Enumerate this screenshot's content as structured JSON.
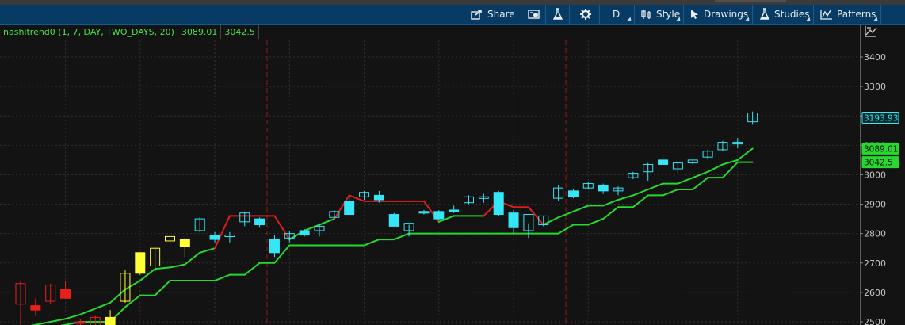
{
  "toolbar": {
    "share": "Share",
    "aggregation": "D",
    "style": "Style",
    "drawings": "Drawings",
    "studies": "Studies",
    "patterns": "Patterns"
  },
  "study": {
    "name": "nashitrend0 (1, 7, DAY, TWO_DAYS, 20)",
    "value1": "3089.01",
    "value2": "3042.5"
  },
  "colors": {
    "toolbar_bg": "#073b63",
    "chart_bg": "#131313",
    "candle_yellow": "#ffff33",
    "candle_red": "#e8201a",
    "candle_cyan": "#35e6f6",
    "trend_green": "#27d92f",
    "trend_red": "#e01c1c",
    "grid": "#2f2f2f",
    "divider": "#9a1a1a"
  },
  "chart_data": {
    "type": "candlestick",
    "y_axis_ticks": [
      2500,
      2600,
      2700,
      2800,
      2900,
      3000,
      3100,
      3200,
      3300,
      3400
    ],
    "ylim": [
      2490,
      3460
    ],
    "price_labels": [
      {
        "text": "3193.93",
        "value": 3193.93,
        "color": "#35e6f6",
        "filled": false
      },
      {
        "text": "3089.01",
        "value": 3089.01,
        "color": "#27d92f",
        "filled": true
      },
      {
        "text": "3042.5",
        "value": 3042.5,
        "color": "#27d92f",
        "filled": true
      }
    ],
    "candles": [
      {
        "o": 2560,
        "h": 2640,
        "l": 2490,
        "c": 2630,
        "color": "red",
        "filled": false
      },
      {
        "o": 2555,
        "h": 2580,
        "l": 2520,
        "c": 2540,
        "color": "red",
        "filled": true
      },
      {
        "o": 2570,
        "h": 2630,
        "l": 2560,
        "c": 2625,
        "color": "red",
        "filled": false
      },
      {
        "o": 2610,
        "h": 2640,
        "l": 2590,
        "c": 2580,
        "color": "red",
        "filled": true
      },
      {
        "o": 2500,
        "h": 2510,
        "l": 2480,
        "c": 2495,
        "color": "red",
        "filled": true
      },
      {
        "o": 2485,
        "h": 2520,
        "l": 2470,
        "c": 2515,
        "color": "red",
        "filled": false
      },
      {
        "o": 2515,
        "h": 2540,
        "l": 2490,
        "c": 2490,
        "color": "yellow",
        "filled": true
      },
      {
        "o": 2570,
        "h": 2675,
        "l": 2565,
        "c": 2665,
        "color": "yellow",
        "filled": false
      },
      {
        "o": 2665,
        "h": 2730,
        "l": 2660,
        "c": 2735,
        "color": "yellow",
        "filled": true
      },
      {
        "o": 2690,
        "h": 2755,
        "l": 2670,
        "c": 2750,
        "color": "yellow",
        "filled": false
      },
      {
        "o": 2775,
        "h": 2820,
        "l": 2760,
        "c": 2790,
        "color": "yellow",
        "filled": false
      },
      {
        "o": 2780,
        "h": 2785,
        "l": 2720,
        "c": 2755,
        "color": "yellow",
        "filled": true
      },
      {
        "o": 2810,
        "h": 2855,
        "l": 2805,
        "c": 2850,
        "color": "cyan",
        "filled": false
      },
      {
        "o": 2795,
        "h": 2805,
        "l": 2770,
        "c": 2780,
        "color": "cyan",
        "filled": true
      },
      {
        "o": 2790,
        "h": 2805,
        "l": 2770,
        "c": 2795,
        "color": "cyan",
        "filled": false
      },
      {
        "o": 2840,
        "h": 2875,
        "l": 2825,
        "c": 2870,
        "color": "cyan",
        "filled": false
      },
      {
        "o": 2850,
        "h": 2855,
        "l": 2820,
        "c": 2830,
        "color": "cyan",
        "filled": true
      },
      {
        "o": 2780,
        "h": 2795,
        "l": 2720,
        "c": 2735,
        "color": "cyan",
        "filled": true
      },
      {
        "o": 2785,
        "h": 2810,
        "l": 2770,
        "c": 2800,
        "color": "cyan",
        "filled": false
      },
      {
        "o": 2810,
        "h": 2815,
        "l": 2790,
        "c": 2795,
        "color": "cyan",
        "filled": true
      },
      {
        "o": 2810,
        "h": 2835,
        "l": 2790,
        "c": 2825,
        "color": "cyan",
        "filled": false
      },
      {
        "o": 2855,
        "h": 2880,
        "l": 2845,
        "c": 2875,
        "color": "cyan",
        "filled": false
      },
      {
        "o": 2910,
        "h": 2925,
        "l": 2865,
        "c": 2865,
        "color": "cyan",
        "filled": true
      },
      {
        "o": 2925,
        "h": 2945,
        "l": 2915,
        "c": 2940,
        "color": "cyan",
        "filled": false
      },
      {
        "o": 2930,
        "h": 2945,
        "l": 2905,
        "c": 2915,
        "color": "cyan",
        "filled": true
      },
      {
        "o": 2865,
        "h": 2870,
        "l": 2825,
        "c": 2825,
        "color": "cyan",
        "filled": true
      },
      {
        "o": 2810,
        "h": 2830,
        "l": 2790,
        "c": 2835,
        "color": "cyan",
        "filled": false
      },
      {
        "o": 2875,
        "h": 2880,
        "l": 2865,
        "c": 2875,
        "color": "cyan",
        "filled": true
      },
      {
        "o": 2875,
        "h": 2880,
        "l": 2845,
        "c": 2850,
        "color": "cyan",
        "filled": true
      },
      {
        "o": 2880,
        "h": 2895,
        "l": 2870,
        "c": 2880,
        "color": "cyan",
        "filled": true
      },
      {
        "o": 2905,
        "h": 2930,
        "l": 2900,
        "c": 2925,
        "color": "cyan",
        "filled": false
      },
      {
        "o": 2920,
        "h": 2935,
        "l": 2905,
        "c": 2925,
        "color": "cyan",
        "filled": false
      },
      {
        "o": 2940,
        "h": 2945,
        "l": 2860,
        "c": 2865,
        "color": "cyan",
        "filled": true
      },
      {
        "o": 2870,
        "h": 2880,
        "l": 2800,
        "c": 2820,
        "color": "cyan",
        "filled": true
      },
      {
        "o": 2810,
        "h": 2835,
        "l": 2785,
        "c": 2865,
        "color": "cyan",
        "filled": false
      },
      {
        "o": 2830,
        "h": 2860,
        "l": 2825,
        "c": 2860,
        "color": "cyan",
        "filled": false
      },
      {
        "o": 2920,
        "h": 2965,
        "l": 2910,
        "c": 2955,
        "color": "cyan",
        "filled": false
      },
      {
        "o": 2945,
        "h": 2950,
        "l": 2920,
        "c": 2925,
        "color": "cyan",
        "filled": true
      },
      {
        "o": 2955,
        "h": 2975,
        "l": 2950,
        "c": 2970,
        "color": "cyan",
        "filled": false
      },
      {
        "o": 2965,
        "h": 2970,
        "l": 2935,
        "c": 2945,
        "color": "cyan",
        "filled": true
      },
      {
        "o": 2955,
        "h": 2960,
        "l": 2930,
        "c": 2945,
        "color": "cyan",
        "filled": false
      },
      {
        "o": 2990,
        "h": 3010,
        "l": 2985,
        "c": 3005,
        "color": "cyan",
        "filled": false
      },
      {
        "o": 3010,
        "h": 3040,
        "l": 2980,
        "c": 3035,
        "color": "cyan",
        "filled": false
      },
      {
        "o": 3050,
        "h": 3065,
        "l": 3030,
        "c": 3035,
        "color": "cyan",
        "filled": true
      },
      {
        "o": 3040,
        "h": 3045,
        "l": 3005,
        "c": 3020,
        "color": "cyan",
        "filled": false
      },
      {
        "o": 3040,
        "h": 3055,
        "l": 3035,
        "c": 3050,
        "color": "cyan",
        "filled": false
      },
      {
        "o": 3060,
        "h": 3085,
        "l": 3055,
        "c": 3080,
        "color": "cyan",
        "filled": false
      },
      {
        "o": 3085,
        "h": 3115,
        "l": 3080,
        "c": 3110,
        "color": "cyan",
        "filled": false
      },
      {
        "o": 3110,
        "h": 3125,
        "l": 3090,
        "c": 3110,
        "color": "cyan",
        "filled": false
      },
      {
        "o": 3180,
        "h": 3215,
        "l": 3170,
        "c": 3210,
        "color": "cyan",
        "filled": false
      }
    ],
    "upper_line": [
      2480,
      2490,
      2500,
      2510,
      2525,
      2545,
      2565,
      2610,
      2640,
      2680,
      2685,
      2695,
      2735,
      2750,
      2860,
      2860,
      2860,
      2860,
      2780,
      2810,
      2830,
      2850,
      2930,
      2910,
      2910,
      2910,
      2910,
      2910,
      2840,
      2860,
      2860,
      2860,
      2910,
      2890,
      2890,
      2830,
      2855,
      2875,
      2895,
      2895,
      2915,
      2930,
      2950,
      2970,
      2970,
      2990,
      3010,
      3035,
      3050,
      3089.01
    ],
    "upper_line_colors": [
      "green",
      "green",
      "green",
      "green",
      "green",
      "green",
      "green",
      "green",
      "green",
      "green",
      "green",
      "green",
      "green",
      "green",
      "red",
      "red",
      "red",
      "red",
      "red",
      "green",
      "green",
      "green",
      "red",
      "red",
      "red",
      "red",
      "red",
      "red",
      "red",
      "green",
      "green",
      "green",
      "red",
      "red",
      "red",
      "red",
      "green",
      "green",
      "green",
      "green",
      "green",
      "green",
      "green",
      "green",
      "green",
      "green",
      "green",
      "green",
      "green",
      "green"
    ],
    "lower_line": [
      2480,
      2480,
      2480,
      2490,
      2500,
      2500,
      2500,
      2550,
      2590,
      2590,
      2640,
      2640,
      2640,
      2640,
      2660,
      2660,
      2700,
      2700,
      2760,
      2760,
      2760,
      2760,
      2760,
      2760,
      2780,
      2780,
      2800,
      2800,
      2800,
      2800,
      2800,
      2800,
      2800,
      2800,
      2800,
      2800,
      2800,
      2830,
      2830,
      2850,
      2890,
      2890,
      2930,
      2930,
      2950,
      2950,
      2990,
      2990,
      3042.5,
      3042.5
    ],
    "period_dividers_after_candle": [
      16,
      36
    ]
  }
}
